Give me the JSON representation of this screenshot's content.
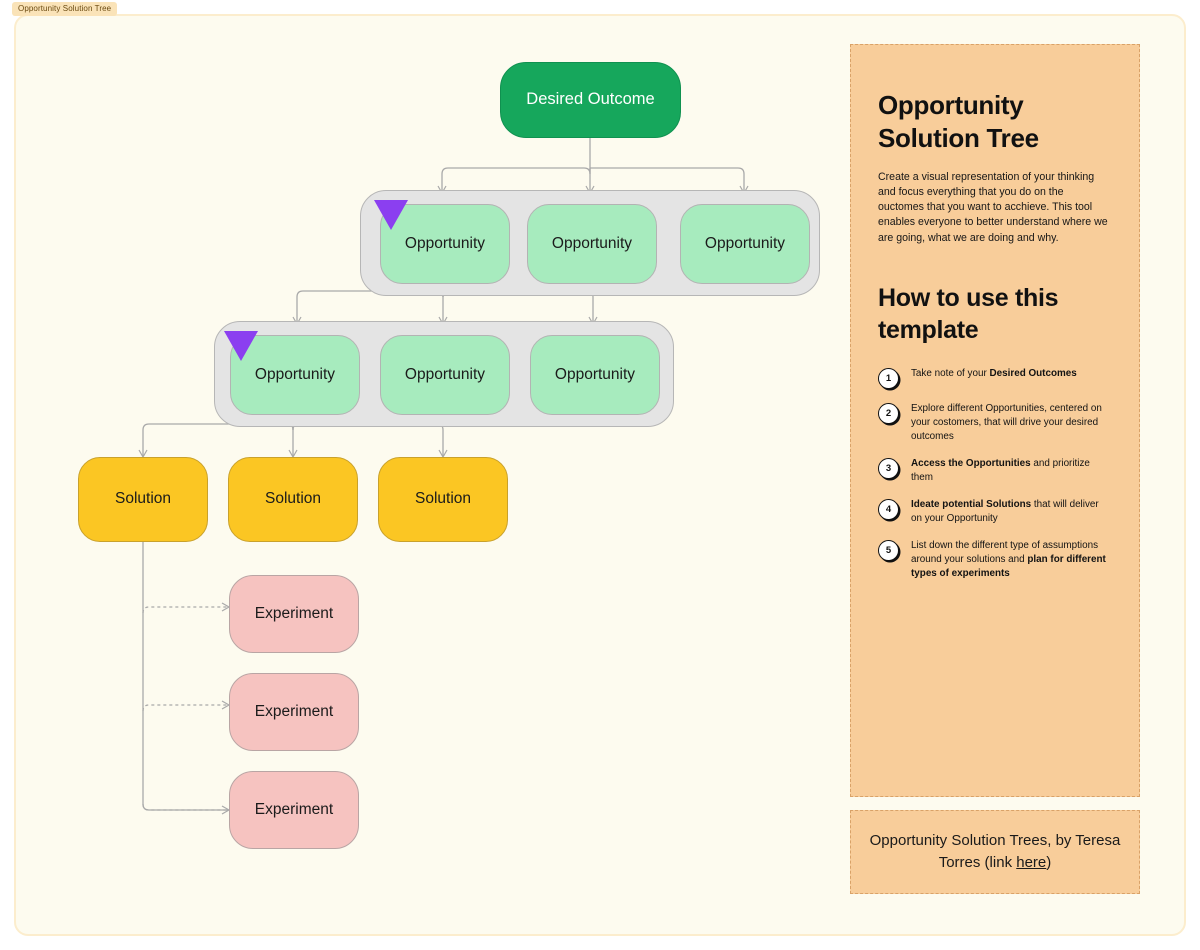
{
  "frame": {
    "tab_label": "Opportunity Solution Tree"
  },
  "tree": {
    "outcome": {
      "label": "Desired Outcome"
    },
    "opportunities_row1": [
      {
        "label": "Opportunity",
        "marked": true
      },
      {
        "label": "Opportunity",
        "marked": false
      },
      {
        "label": "Opportunity",
        "marked": false
      }
    ],
    "opportunities_row2": [
      {
        "label": "Opportunity",
        "marked": true
      },
      {
        "label": "Opportunity",
        "marked": false
      },
      {
        "label": "Opportunity",
        "marked": false
      }
    ],
    "solutions": [
      {
        "label": "Solution"
      },
      {
        "label": "Solution"
      },
      {
        "label": "Solution"
      }
    ],
    "experiments": [
      {
        "label": "Experiment"
      },
      {
        "label": "Experiment"
      },
      {
        "label": "Experiment"
      }
    ]
  },
  "sidebar": {
    "title": "Opportunity Solution Tree",
    "description": "Create a visual representation of your thinking and focus everything that you do on the ouctomes that you want to acchieve. This tool enables everyone to better understand where we are going, what we are doing and why.",
    "how_to_title": "How to use this template",
    "steps": [
      {
        "number": "1",
        "html": "Take note of your <b>Desired Outcomes</b>"
      },
      {
        "number": "2",
        "html": "Explore different Opportunities, centered on your costomers, that will drive your desired outcomes"
      },
      {
        "number": "3",
        "html": "<b>Access the Opportunities</b> and prioritize them"
      },
      {
        "number": "4",
        "html": "<b>Ideate potential Solutions</b> that will deliver on your Opportunity"
      },
      {
        "number": "5",
        "html": "List down the different type of assumptions around your solutions and <b>plan for different types of experiments</b>"
      }
    ]
  },
  "footer": {
    "text_before": "Opportunity Solution Trees, by Teresa Torres (link ",
    "link_label": "here",
    "text_after": ")"
  },
  "colors": {
    "outcome": "#16a75c",
    "opportunity": "#a7ebbe",
    "solution": "#fbc623",
    "experiment": "#f6c3c0",
    "group": "#e4e4e4",
    "marker": "#8b3ff0",
    "sidebar": "#f8cd9a",
    "canvas": "#fdfbef"
  }
}
